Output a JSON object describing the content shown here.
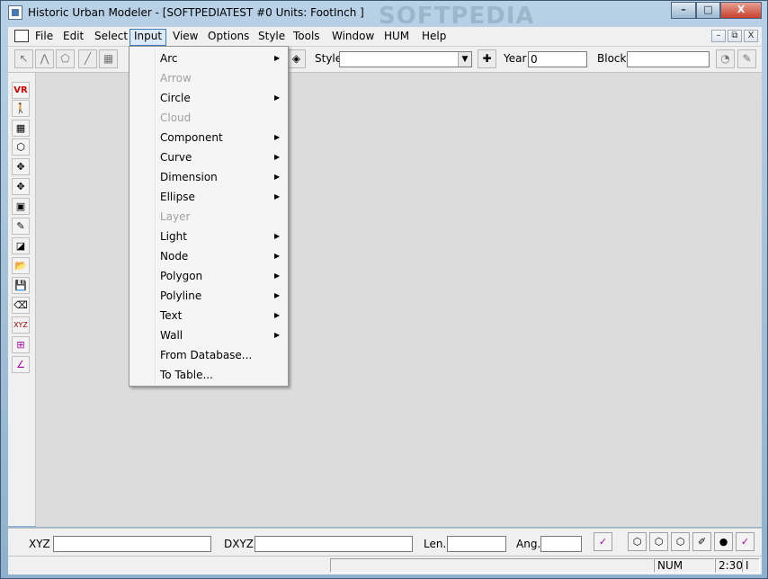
{
  "window": {
    "title": "Historic Urban Modeler - [SOFTPEDIATEST #0  Units: FootInch ]",
    "minimize": "–",
    "maximize": "□",
    "close": "X",
    "watermark": "SOFTPEDIA"
  },
  "menubar": {
    "items": [
      "File",
      "Edit",
      "Select",
      "Input",
      "View",
      "Options",
      "Style",
      "Tools",
      "Window",
      "HUM",
      "Help"
    ],
    "active": "Input",
    "mdi": [
      "–",
      "⧉",
      "X"
    ]
  },
  "toolbar": {
    "style_label": "Style",
    "style_value": "",
    "year_label": "Year",
    "year_value": "0",
    "block_label": "Block",
    "block_value": ""
  },
  "input_menu": {
    "items": [
      {
        "label": "Arc",
        "submenu": true,
        "disabled": false
      },
      {
        "label": "Arrow",
        "submenu": false,
        "disabled": true
      },
      {
        "label": "Circle",
        "submenu": true,
        "disabled": false
      },
      {
        "label": "Cloud",
        "submenu": false,
        "disabled": true
      },
      {
        "label": "Component",
        "submenu": true,
        "disabled": false
      },
      {
        "label": "Curve",
        "submenu": true,
        "disabled": false
      },
      {
        "label": "Dimension",
        "submenu": true,
        "disabled": false
      },
      {
        "label": "Ellipse",
        "submenu": true,
        "disabled": false
      },
      {
        "label": "Layer",
        "submenu": false,
        "disabled": true
      },
      {
        "label": "Light",
        "submenu": true,
        "disabled": false
      },
      {
        "label": "Node",
        "submenu": true,
        "disabled": false
      },
      {
        "label": "Polygon",
        "submenu": true,
        "disabled": false
      },
      {
        "label": "Polyline",
        "submenu": true,
        "disabled": false
      },
      {
        "label": "Text",
        "submenu": true,
        "disabled": false
      },
      {
        "label": "Wall",
        "submenu": true,
        "disabled": false
      },
      {
        "label": "From Database...",
        "submenu": false,
        "disabled": false
      },
      {
        "label": "To Table...",
        "submenu": false,
        "disabled": false
      }
    ]
  },
  "left_toolbar": {
    "vr_label": "VR",
    "xyz_label": "XYZ"
  },
  "bottom": {
    "xyz_label": "XYZ",
    "xyz_value": "",
    "dxyz_label": "DXYZ",
    "dxyz_value": "",
    "len_label": "Len.",
    "len_value": "",
    "ang_label": "Ang.",
    "ang_value": ""
  },
  "status": {
    "num": "NUM",
    "time": "2:30",
    "extra": "I"
  },
  "icons": [
    "app-icon",
    "pointer-icon",
    "polyline-tool-icon",
    "polygon-tool-icon",
    "line-tool-icon",
    "layers-icon",
    "plus-icon",
    "render-icon",
    "vr-icon",
    "walk-icon",
    "grid-icon",
    "cube-icon",
    "move-icon",
    "rotate-icon",
    "copy-icon",
    "paint-icon",
    "frame-icon",
    "open-folder-icon",
    "save-icon",
    "erase-icon",
    "query-xyz-icon",
    "measure-icon",
    "angle-icon",
    "view-cube-icon"
  ]
}
